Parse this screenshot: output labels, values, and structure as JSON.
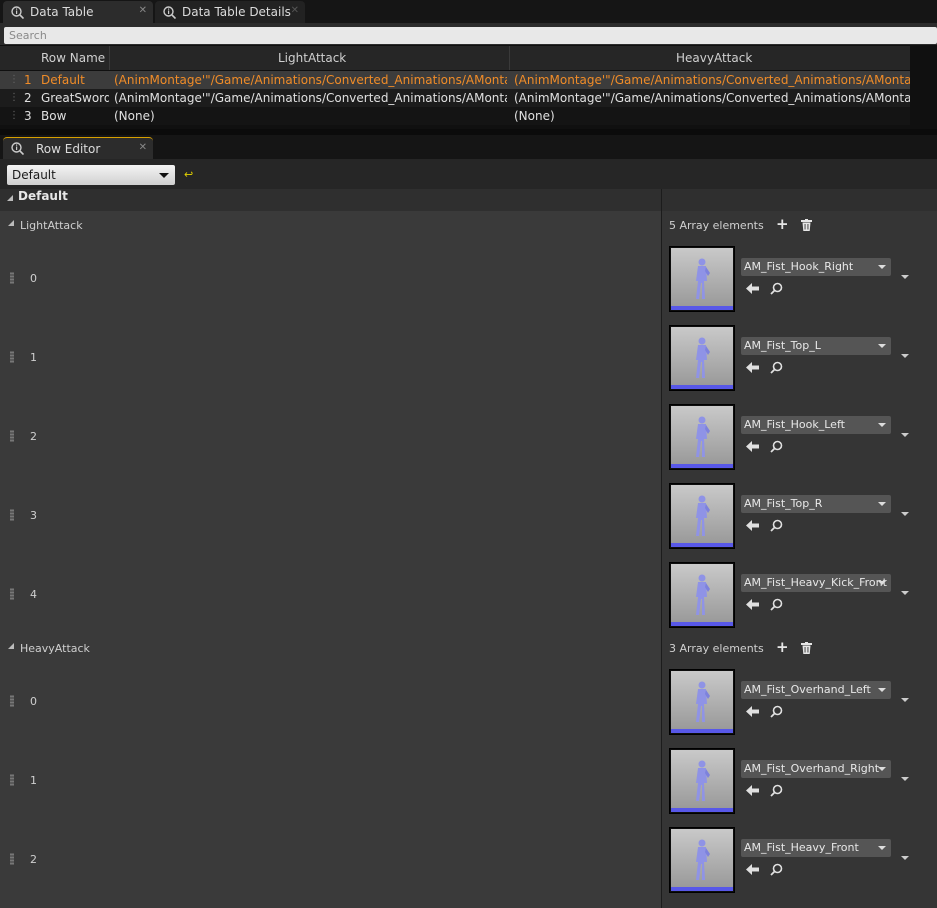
{
  "top_tabs": [
    {
      "label": "Data Table",
      "active": true
    },
    {
      "label": "Data Table Details",
      "active": false
    }
  ],
  "search": {
    "placeholder": "Search"
  },
  "table": {
    "headers": {
      "row_name": "Row Name",
      "col1": "LightAttack",
      "col2": "HeavyAttack"
    },
    "rows": [
      {
        "num": "1",
        "name": "Default",
        "light": "(AnimMontage'\"/Game/Animations/Converted_Animations/AMontages/F",
        "heavy": "(AnimMontage'\"/Game/Animations/Converted_Animations/AMontages/F"
      },
      {
        "num": "2",
        "name": "GreatSword",
        "light": "(AnimMontage'\"/Game/Animations/Converted_Animations/AMontages/S",
        "heavy": "(AnimMontage'\"/Game/Animations/Converted_Animations/AMontages/S"
      },
      {
        "num": "3",
        "name": "Bow",
        "light": "(None)",
        "heavy": "(None)"
      }
    ]
  },
  "row_editor": {
    "tab_label": "Row Editor",
    "selected_row": "Default",
    "category": "Default",
    "light_attack": {
      "label": "LightAttack",
      "count_text": "5 Array elements",
      "items": [
        {
          "index": "0",
          "asset": "AM_Fist_Hook_Right"
        },
        {
          "index": "1",
          "asset": "AM_Fist_Top_L"
        },
        {
          "index": "2",
          "asset": "AM_Fist_Hook_Left"
        },
        {
          "index": "3",
          "asset": "AM_Fist_Top_R"
        },
        {
          "index": "4",
          "asset": "AM_Fist_Heavy_Kick_Front"
        }
      ]
    },
    "heavy_attack": {
      "label": "HeavyAttack",
      "count_text": "3 Array elements",
      "items": [
        {
          "index": "0",
          "asset": "AM_Fist_Overhand_Left"
        },
        {
          "index": "1",
          "asset": "AM_Fist_Overhand_Right"
        },
        {
          "index": "2",
          "asset": "AM_Fist_Heavy_Front"
        }
      ]
    }
  },
  "colors": {
    "selected_row_text": "#f08c28",
    "thumbnail_bar": "#5858e8",
    "reset_arrow": "#e0d000"
  }
}
